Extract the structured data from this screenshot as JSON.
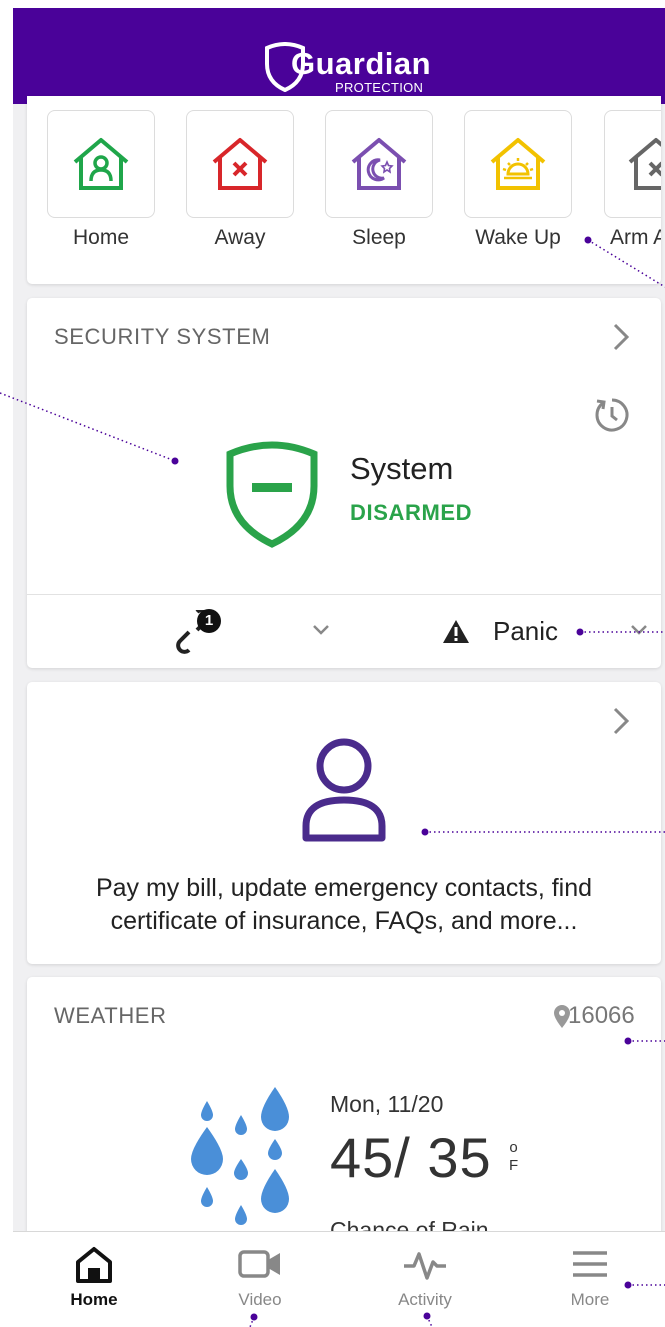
{
  "header": {
    "brand": "Guardian",
    "brand_sub": "PROTECTION",
    "bg_color": "#4a0299"
  },
  "scenes": [
    {
      "label": "Home",
      "color": "#1fa64a",
      "icon": "home-scene-icon"
    },
    {
      "label": "Away",
      "color": "#d8262a",
      "icon": "away-scene-icon"
    },
    {
      "label": "Sleep",
      "color": "#7b4fb0",
      "icon": "sleep-scene-icon"
    },
    {
      "label": "Wake Up",
      "color": "#f2c200",
      "icon": "wake-up-scene-icon"
    },
    {
      "label": "Arm A",
      "color": "#666666",
      "icon": "arm-scene-icon"
    }
  ],
  "security": {
    "title": "SECURITY SYSTEM",
    "system_label": "System",
    "status": "DISARMED",
    "status_color": "#2aa34a",
    "link_badge": "1",
    "panic_label": "Panic"
  },
  "account": {
    "text": "Pay my bill, update emergency contacts, find certificate of insurance, FAQs, and more...",
    "icon_color": "#4a2b8c"
  },
  "weather": {
    "title": "WEATHER",
    "zip": "16066",
    "date": "Mon, 11/20",
    "temp": "45/ 35",
    "unit": "o\nF",
    "condition": "Chance of Rain",
    "drop_color": "#4a8fd8"
  },
  "tabs": [
    {
      "label": "Home",
      "active": true
    },
    {
      "label": "Video",
      "active": false
    },
    {
      "label": "Activity",
      "active": false
    },
    {
      "label": "More",
      "active": false
    }
  ]
}
